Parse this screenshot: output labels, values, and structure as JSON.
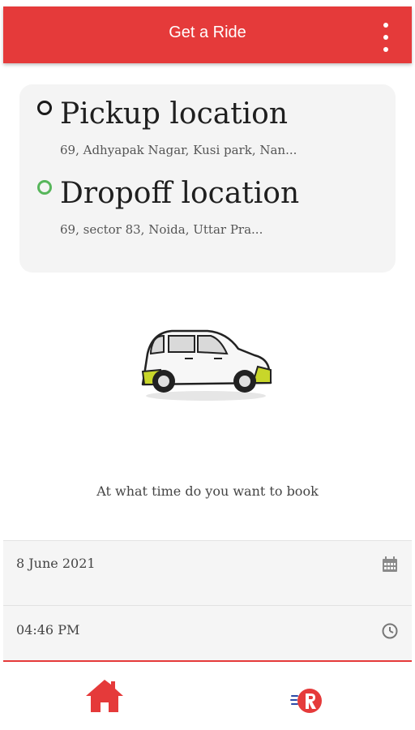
{
  "app_bar": {
    "title": "Get a Ride",
    "menu_icon": "more-vert-icon"
  },
  "locations": {
    "pickup": {
      "title": "Pickup location",
      "address": "69, Adhyapak Nagar, Kusi park, Nan..."
    },
    "dropoff": {
      "title": "Dropoff location",
      "address": "69, sector 83, Noida, Uttar Pra..."
    }
  },
  "booking": {
    "question": "At what time do you want to book",
    "date": "8 June 2021",
    "time": "04:46 PM"
  },
  "bottom_nav": {
    "home_icon": "home-icon",
    "ride_icon": "ride-logo-icon"
  },
  "colors": {
    "primary": "#e53a3a",
    "card_bg": "#f4f4f4",
    "dropoff_dot": "#57b65b",
    "car_accent": "#c8d62a"
  }
}
